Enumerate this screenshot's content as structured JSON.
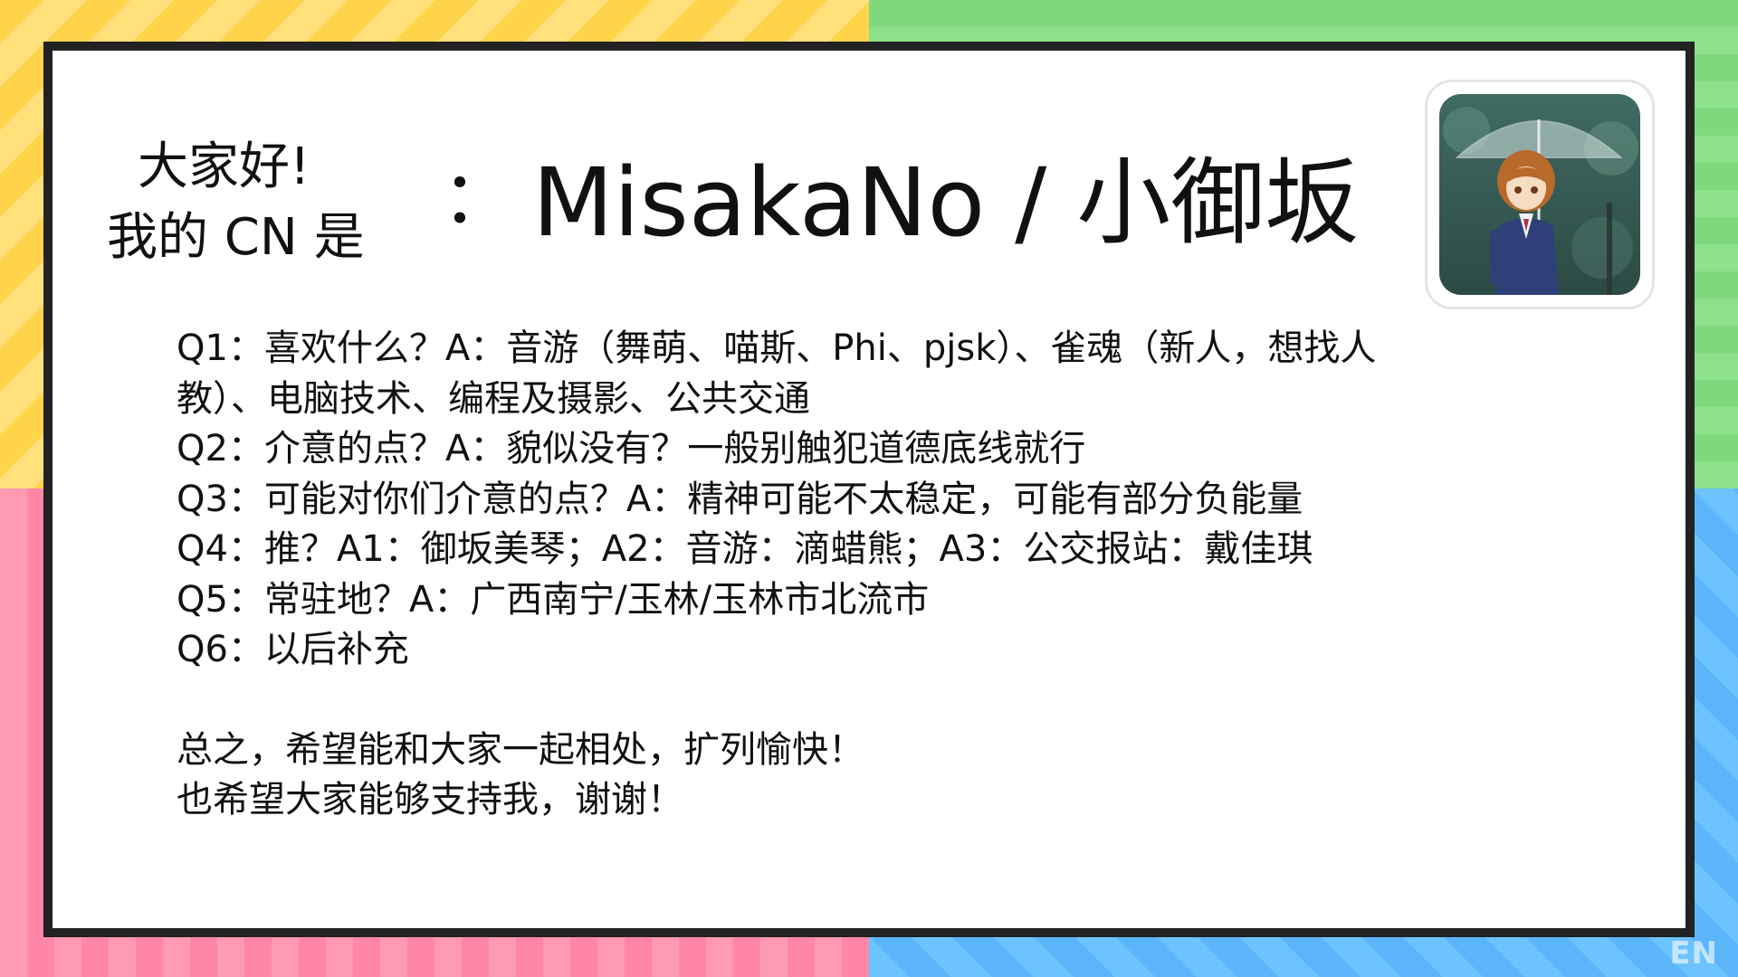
{
  "greeting": {
    "line1": "大家好!",
    "line2": "我的 CN 是"
  },
  "separator": "：",
  "cn_name": "MisakaNo / 小御坂",
  "avatar_icon": "anime-girl-umbrella-avatar",
  "qa_lines": [
    "Q1：喜欢什么？A：音游（舞萌、喵斯、Phi、pjsk）、雀魂（新人，想找人",
    "教）、电脑技术、编程及摄影、公共交通",
    "Q2：介意的点？A：貌似没有？一般别触犯道德底线就行",
    "Q3：可能对你们介意的点？A：精神可能不太稳定，可能有部分负能量",
    "Q4：推？A1：御坂美琴；A2：音游：滴蜡熊；A3：公交报站：戴佳琪",
    "Q5：常驻地？A：广西南宁/玉林/玉林市北流市",
    "Q6：以后补充"
  ],
  "closing": [
    "总之，希望能和大家一起相处，扩列愉快！",
    "也希望大家能够支持我，谢谢！"
  ],
  "corner_mark": "EN",
  "colors": {
    "frame": "#222222",
    "yellow": "#ffd34a",
    "green": "#8ee08a",
    "pink": "#ff9ab3",
    "blue": "#6cc3ff"
  }
}
